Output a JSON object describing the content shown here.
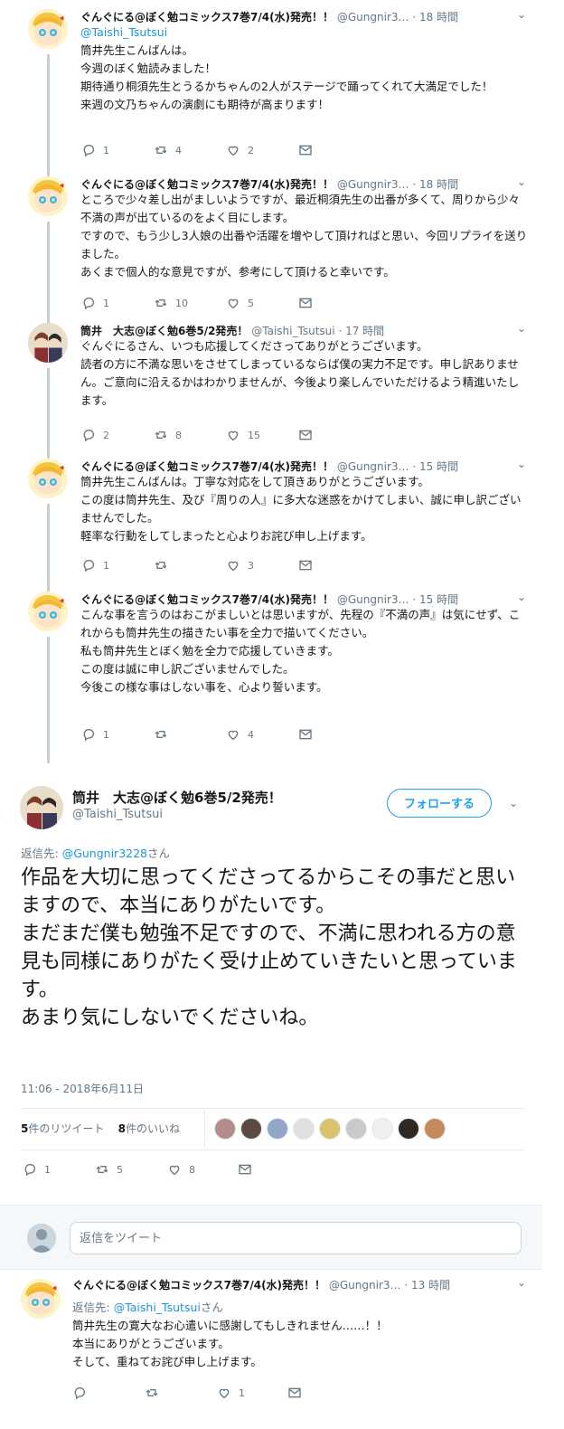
{
  "thread": [
    {
      "name": "ぐんぐにる@ぼく勉コミックス7巻7/4(水)発売！！",
      "handle": "@Gungnir3…",
      "time": "18 時間",
      "mention": "@Taishi_Tsutsui",
      "lines": [
        "筒井先生こんばんは。",
        "今週のぼく勉読みました！",
        "期待通り桐須先生とうるかちゃんの2人がステージで踊ってくれて大満足でした！",
        "来週の文乃ちゃんの演劇にも期待が高まります！"
      ],
      "replies": "1",
      "retweets": "4",
      "likes": "2"
    },
    {
      "name": "ぐんぐにる@ぼく勉コミックス7巻7/4(水)発売！！",
      "handle": "@Gungnir3…",
      "time": "18 時間",
      "mention": "",
      "lines": [
        "ところで少々差し出がましいようですが、最近桐須先生の出番が多くて、周りから少々不満の声が出ているのをよく目にします。",
        "ですので、もう少し3人娘の出番や活躍を増やして頂ければと思い、今回リプライを送りました。",
        "あくまで個人的な意見ですが、参考にして頂けると幸いです。"
      ],
      "replies": "1",
      "retweets": "10",
      "likes": "5"
    },
    {
      "name": "筒井　大志@ぼく勉6巻5/2発売！",
      "handle": "@Taishi_Tsutsui",
      "time": "17 時間",
      "mention": "",
      "lines": [
        "ぐんぐにるさん、いつも応援してくださってありがとうございます。",
        "読者の方に不満な思いをさせてしまっているならば僕の実力不足です。申し訳ありません。ご意向に沿えるかはわかりませんが、今後より楽しんでいただけるよう精進いたします。"
      ],
      "replies": "2",
      "retweets": "8",
      "likes": "15"
    },
    {
      "name": "ぐんぐにる@ぼく勉コミックス7巻7/4(水)発売！！",
      "handle": "@Gungnir3…",
      "time": "15 時間",
      "mention": "",
      "lines": [
        "筒井先生こんばんは。丁寧な対応をして頂きありがとうございます。",
        "この度は筒井先生、及び『周りの人』に多大な迷惑をかけてしまい、誠に申し訳ございませんでした。",
        "軽率な行動をしてしまったと心よりお詫び申し上げます。"
      ],
      "replies": "1",
      "retweets": "",
      "likes": "3"
    },
    {
      "name": "ぐんぐにる@ぼく勉コミックス7巻7/4(水)発売！！",
      "handle": "@Gungnir3…",
      "time": "15 時間",
      "mention": "",
      "lines": [
        "こんな事を言うのはおこがましいとは思いますが、先程の『不満の声』は気にせず、これからも筒井先生の描きたい事を全力で描いてください。",
        "私も筒井先生とぼく勉を全力で応援していきます。",
        "",
        "この度は誠に申し訳ございませんでした。",
        "今後この様な事はしない事を、心より誓います。"
      ],
      "replies": "1",
      "retweets": "",
      "likes": "4"
    }
  ],
  "main": {
    "name": "筒井　大志@ぼく勉6巻5/2発売！",
    "handle": "@Taishi_Tsutsui",
    "follow_label": "フォローする",
    "reply_prefix": "返信先: ",
    "reply_mention": "@Gungnir3228",
    "reply_suffix": "さん",
    "text_lines": [
      "作品を大切に思ってくださってるからこその事だと思いますので、本当にありがたいです。",
      "まだまだ僕も勉強不足ですので、不満に思われる方の意見も同様にありがたく受け止めていきたいと思っています。",
      "あまり気にしないでくださいね。"
    ],
    "timestamp": "11:06 - 2018年6月11日",
    "retweet_count": "5",
    "retweet_label": "件のリツイート",
    "like_count": "8",
    "like_label": "件のいいね",
    "replies": "1",
    "retweets": "5",
    "likes": "8",
    "liker_colors": [
      "#b48c8c",
      "#5a4a42",
      "#8fa6c8",
      "#e0e0e0",
      "#d8c46a",
      "#c9c9c9",
      "#f0f0f0",
      "#2e2a22",
      "#c48a5a"
    ]
  },
  "replybox": {
    "placeholder": "返信をツイート"
  },
  "last": {
    "name": "ぐんぐにる@ぼく勉コミックス7巻7/4(水)発売！！",
    "handle": "@Gungnir3…",
    "time": "13 時間",
    "reply_prefix": "返信先: ",
    "reply_mention": "@Taishi_Tsutsui",
    "reply_suffix": "さん",
    "lines": [
      "筒井先生の寛大なお心遣いに感謝してもしきれません……！！",
      "本当にありがとうございます。",
      "そして、重ねてお詫び申し上げます。"
    ],
    "replies": "",
    "retweets": "",
    "likes": "1"
  },
  "icons": {
    "reply": "reply-icon",
    "retweet": "retweet-icon",
    "like": "heart-icon",
    "dm": "envelope-icon",
    "caret": "chevron-down-icon"
  },
  "colors": {
    "link": "#1b95e0",
    "follow": "#1da1f2",
    "thread_line": "#c4cfd6",
    "muted": "#657786"
  }
}
